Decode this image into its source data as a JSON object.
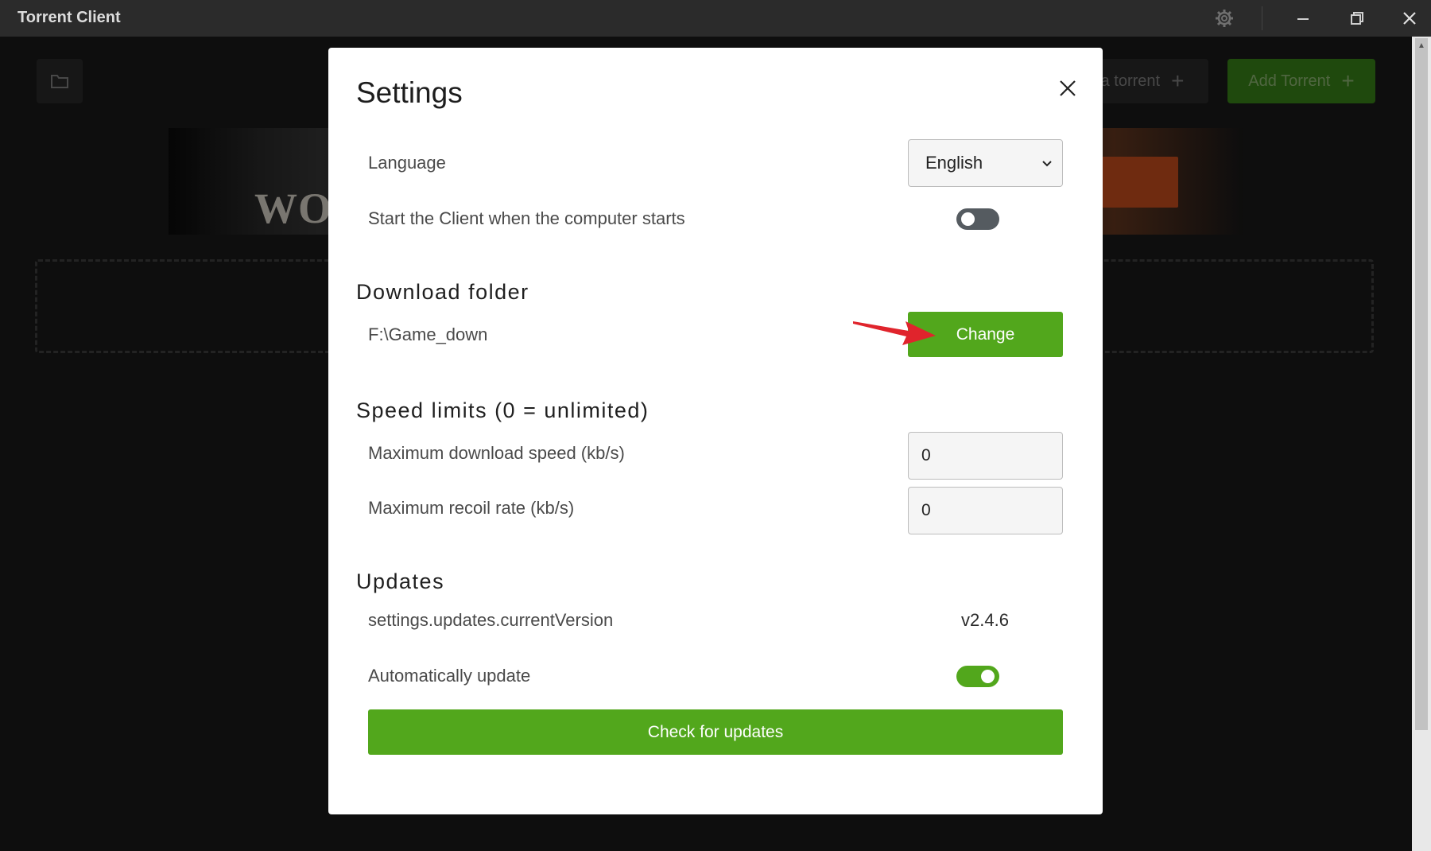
{
  "app": {
    "title": "Torrent Client",
    "icons": [
      "gear-icon",
      "minimize-icon",
      "restore-icon",
      "close-icon"
    ]
  },
  "background": {
    "header_buttons": [
      {
        "label": "a torrent",
        "icon": "plus-icon"
      },
      {
        "label": "Add Torrent",
        "icon": "plus-icon"
      }
    ],
    "banner_text": "WORI"
  },
  "settings": {
    "title": "Settings",
    "language": {
      "label": "Language",
      "value": "English"
    },
    "autostart": {
      "label": "Start the Client when the computer starts",
      "enabled": false
    },
    "download": {
      "section_title": "Download folder",
      "path": "F:\\Game_down",
      "change_label": "Change"
    },
    "speed": {
      "section_title": "Speed limits (0 = unlimited)",
      "download_label": "Maximum download speed (kb/s)",
      "download_value": "0",
      "upload_label": "Maximum recoil rate (kb/s)",
      "upload_value": "0"
    },
    "updates": {
      "section_title": "Updates",
      "version_label": "settings.updates.currentVersion",
      "version_value": "v2.4.6",
      "auto_label": "Automatically update",
      "auto_enabled": true,
      "check_label": "Check for updates"
    }
  },
  "colors": {
    "accent_green": "#52a71c",
    "annotation_arrow": "#e0242c"
  }
}
